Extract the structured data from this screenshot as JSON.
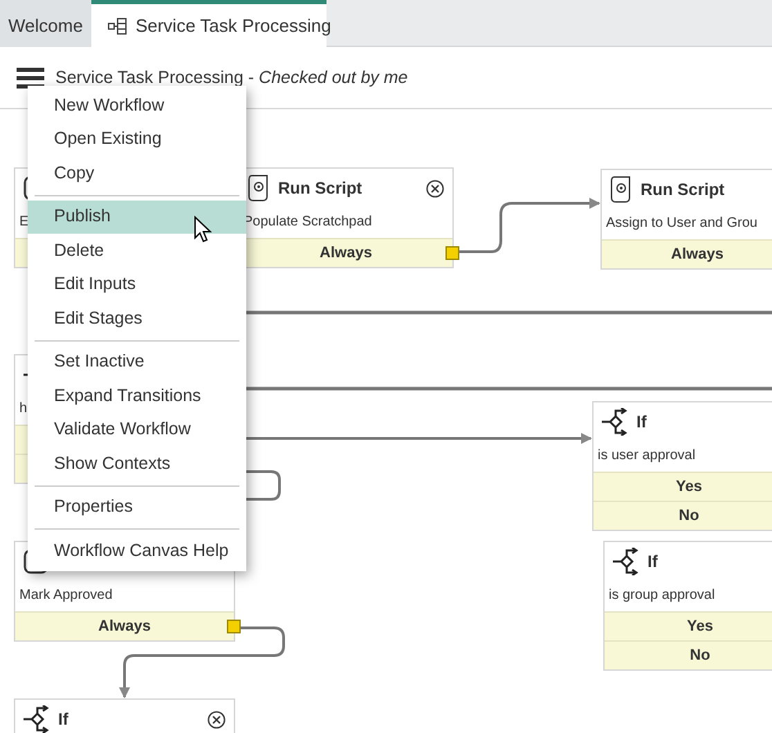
{
  "tabs": [
    {
      "label": "Welcome",
      "selected": false
    },
    {
      "label": "Service Task Processing",
      "selected": true
    }
  ],
  "header": {
    "title": "Service Task Processing - *Checked out by me*"
  },
  "nodes": [
    {
      "kind": "activity",
      "description": "E",
      "transitions": [
        {
          "kind": "covered"
        }
      ]
    },
    {
      "kind": "script",
      "title": "Run Script",
      "description": "Populate Scratchpad",
      "removable": true,
      "transitions": [
        {
          "kind": "label",
          "label": "Always",
          "connected": true
        }
      ]
    },
    {
      "kind": "script",
      "title": "Run Script",
      "description": "Assign to User and Grou",
      "removable": false,
      "transitions": [
        {
          "kind": "label",
          "label": "Always"
        }
      ]
    },
    {
      "kind": "if",
      "description": "h",
      "transitions": [
        {
          "kind": "covered"
        },
        {
          "kind": "covered"
        }
      ]
    },
    {
      "kind": "if",
      "title": "If",
      "description": "is user approval",
      "removable": false,
      "transitions": [
        {
          "kind": "label",
          "label": "Yes"
        },
        {
          "kind": "label",
          "label": "No"
        }
      ]
    },
    {
      "kind": "activity",
      "description": "Mark Approved",
      "removable": false,
      "transitions": [
        {
          "kind": "label",
          "label": "Always",
          "connected": true
        }
      ]
    },
    {
      "kind": "if",
      "title": "If",
      "description": "is group approval",
      "removable": false,
      "transitions": [
        {
          "kind": "label",
          "label": "Yes"
        },
        {
          "kind": "label",
          "label": "No"
        }
      ]
    },
    {
      "kind": "if",
      "title": "If",
      "removable": true
    }
  ],
  "menu": {
    "groups": [
      [
        {
          "label": "New Workflow",
          "selected": false
        },
        {
          "label": "Open Existing",
          "selected": false
        },
        {
          "label": "Copy",
          "selected": false
        }
      ],
      [
        {
          "label": "Publish",
          "selected": true
        },
        {
          "label": "Delete",
          "selected": false
        },
        {
          "label": "Edit Inputs",
          "selected": false
        },
        {
          "label": "Edit Stages",
          "selected": false
        }
      ],
      [
        {
          "label": "Set Inactive",
          "selected": false
        },
        {
          "label": "Expand Transitions",
          "selected": false
        },
        {
          "label": "Validate Workflow",
          "selected": false
        },
        {
          "label": "Show Contexts",
          "selected": false
        }
      ],
      [
        {
          "label": "Properties",
          "selected": false
        }
      ],
      [
        {
          "label": "Workflow Canvas Help",
          "selected": false
        }
      ]
    ]
  }
}
